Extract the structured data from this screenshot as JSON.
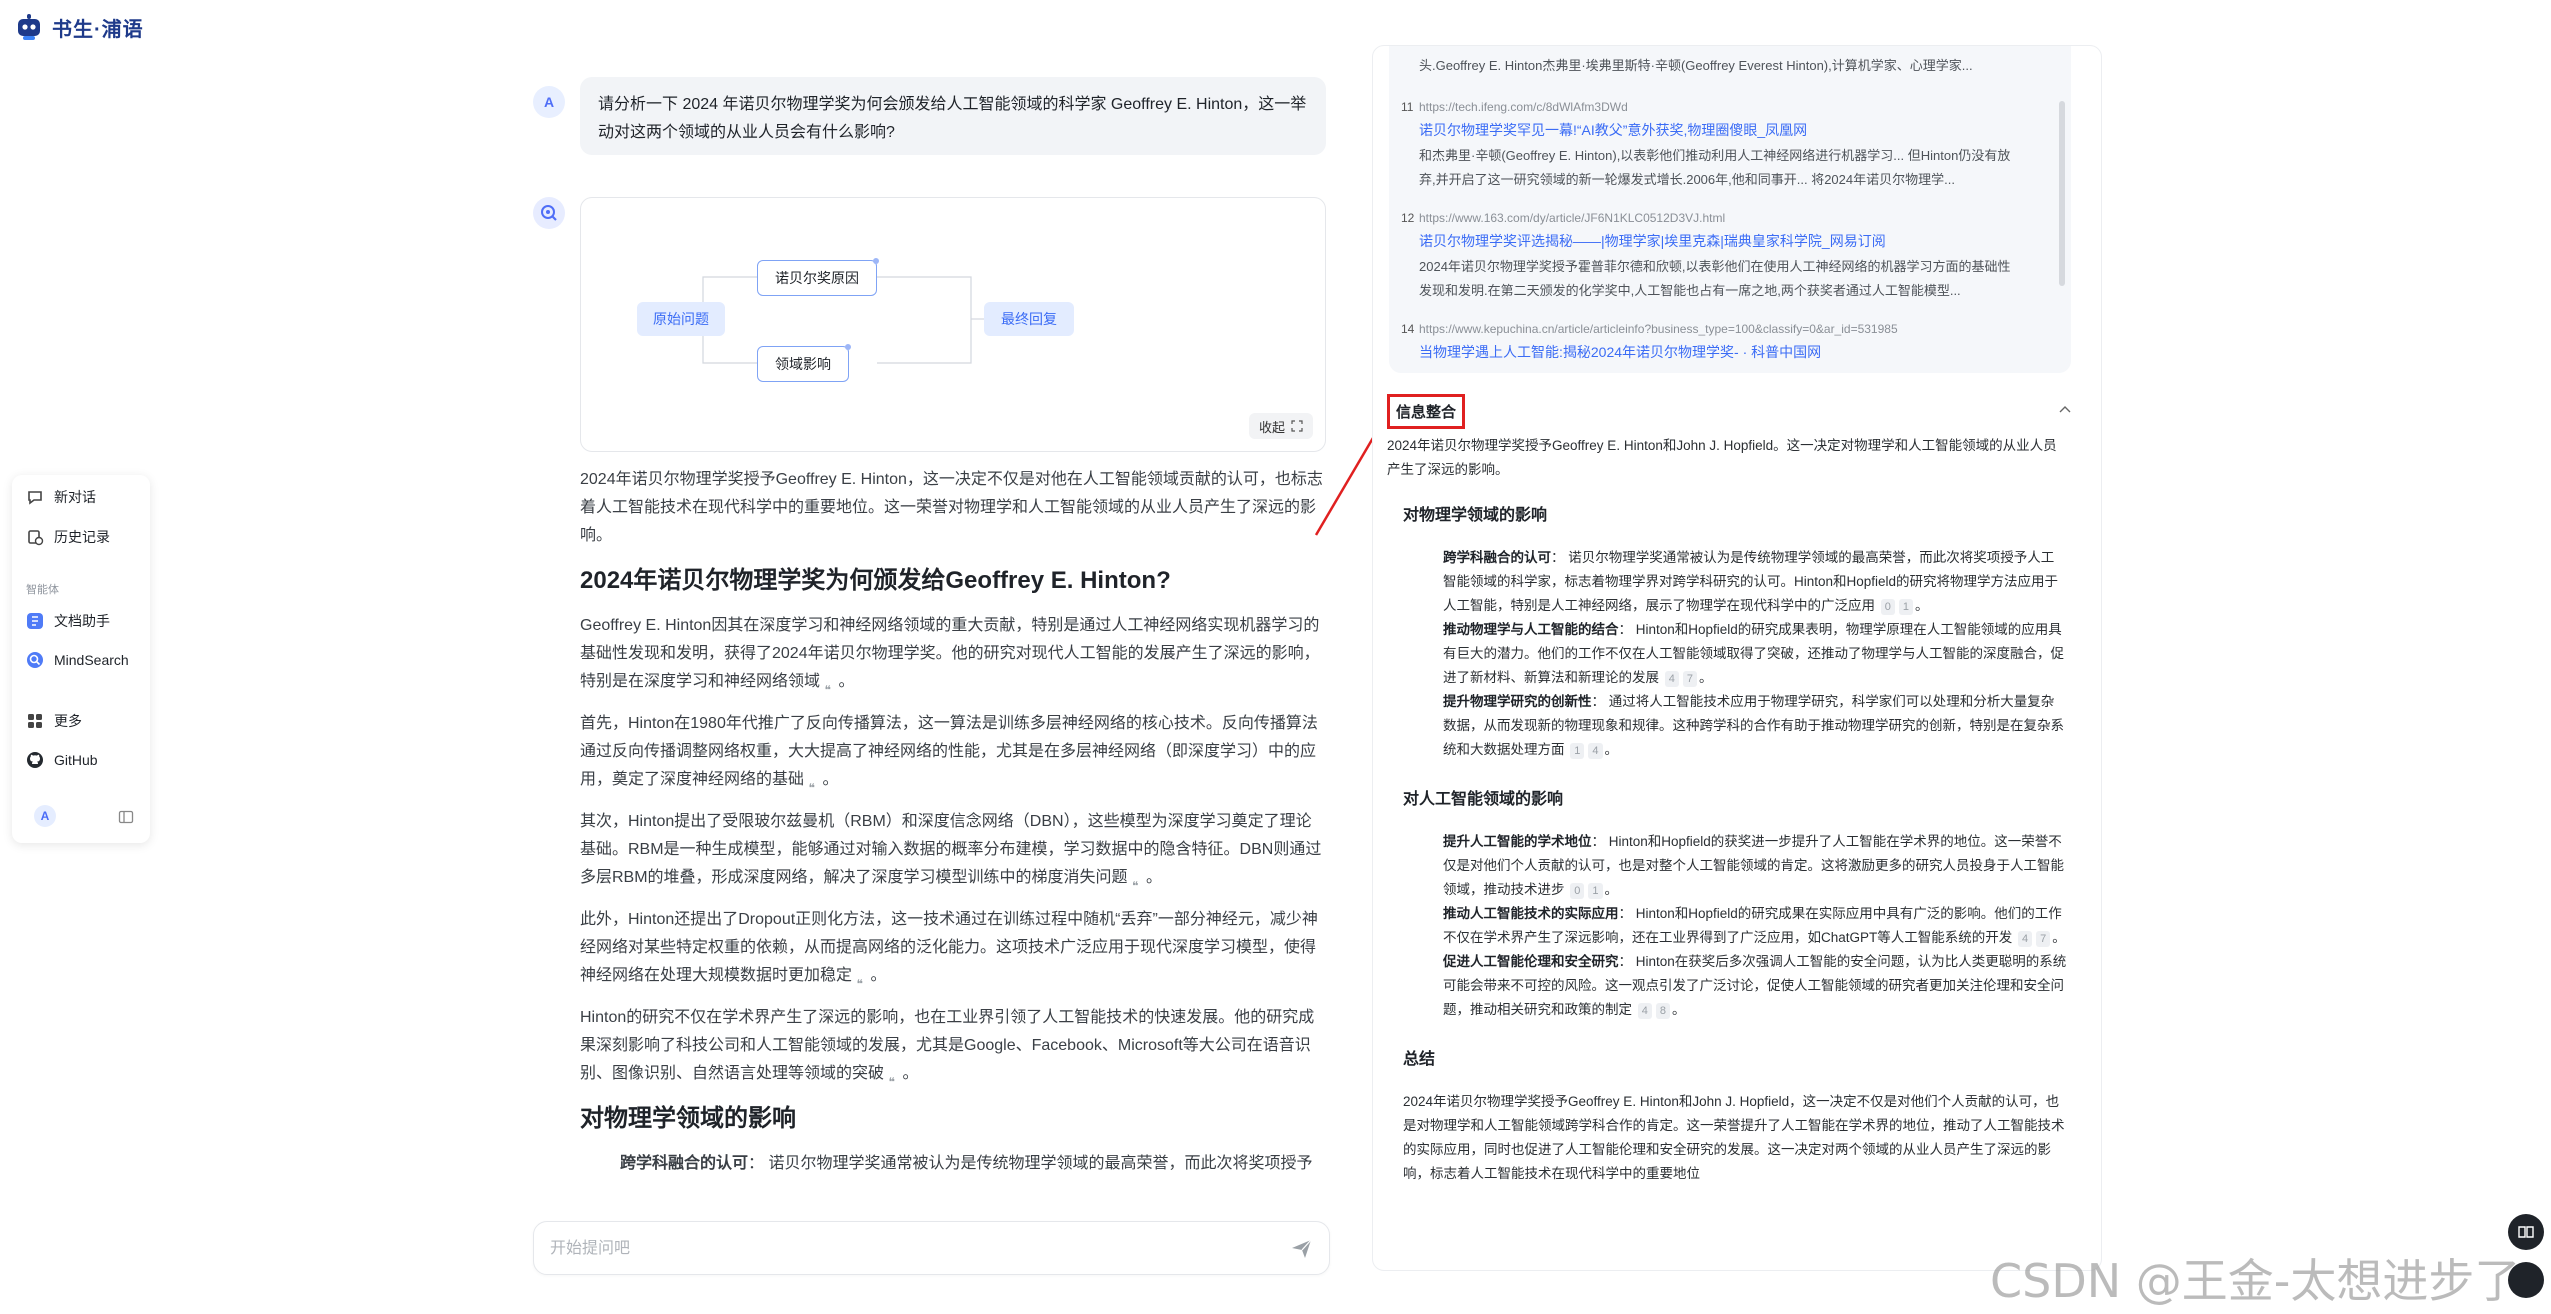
{
  "app": {
    "logo_text": "书生·浦语"
  },
  "sidebar": {
    "new_chat": "新对话",
    "history": "历史记录",
    "section_agents": "智能体",
    "doc_assistant": "文档助手",
    "mindsearch": "MindSearch",
    "more": "更多",
    "github": "GitHub",
    "avatar_letter": "A"
  },
  "chat": {
    "user_avatar_letter": "A",
    "user_question": "请分析一下 2024 年诺贝尔物理学奖为何会颁发给人工智能领域的科学家 Geoffrey E. Hinton，这一举动对这两个领域的从业人员会有什么影响?",
    "graph": {
      "node_origin": "原始问题",
      "node_reason": "诺贝尔奖原因",
      "node_impact": "领域影响",
      "node_final": "最终回复",
      "collapse_label": "收起"
    },
    "answer": {
      "intro": "2024年诺贝尔物理学奖授予Geoffrey E. Hinton，这一决定不仅是对他在人工智能领域贡献的认可，也标志着人工智能技术在现代科学中的重要地位。这一荣誉对物理学和人工智能领域的从业人员产生了深远的影响。",
      "h1": "2024年诺贝尔物理学奖为何颁发给Geoffrey E. Hinton?",
      "p1": "Geoffrey E. Hinton因其在深度学习和神经网络领域的重大贡献，特别是通过人工神经网络实现机器学习的基础性发现和发明，获得了2024年诺贝尔物理学奖。他的研究对现代人工智能的发展产生了深远的影响，特别是在深度学习和神经网络领域",
      "p2": "首先，Hinton在1980年代推广了反向传播算法，这一算法是训练多层神经网络的核心技术。反向传播算法通过反向传播调整网络权重，大大提高了神经网络的性能，尤其是在多层神经网络（即深度学习）中的应用，奠定了深度神经网络的基础",
      "p3": "其次，Hinton提出了受限玻尔兹曼机（RBM）和深度信念网络（DBN），这些模型为深度学习奠定了理论基础。RBM是一种生成模型，能够通过对输入数据的概率分布建模，学习数据中的隐含特征。DBN则通过多层RBM的堆叠，形成深度网络，解决了深度学习模型训练中的梯度消失问题",
      "p4": "此外，Hinton还提出了Dropout正则化方法，这一技术通过在训练过程中随机“丢弃”一部分神经元，减少神经网络对某些特定权重的依赖，从而提高网络的泛化能力。这项技术广泛应用于现代深度学习模型，使得神经网络在处理大规模数据时更加稳定",
      "p5": "Hinton的研究不仅在学术界产生了深远的影响，也在工业界引领了人工智能技术的快速发展。他的研究成果深刻影响了科技公司和人工智能领域的发展，尤其是Google、Facebook、Microsoft等大公司在语音识别、图像识别、自然语言处理等领域的突破",
      "h2": "对物理学领域的影响",
      "b1_label": "跨学科融合的认可",
      "b1_text": "：  诺贝尔物理学奖通常被认为是传统物理学领域的最高荣誉，而此次将奖项授予"
    },
    "input_placeholder": "开始提问吧"
  },
  "sources": [
    {
      "num": "",
      "url": "",
      "title": "",
      "snippet": "头.Geoffrey E. Hinton杰弗里·埃弗里斯特·辛顿(Geoffrey Everest Hinton),计算机学家、心理学家..."
    },
    {
      "num": "11",
      "url": "https://tech.ifeng.com/c/8dWlAfm3DWd",
      "title": "诺贝尔物理学奖罕见一幕!“AI教父”意外获奖,物理圈傻眼_凤凰网",
      "snippet": "和杰弗里·辛顿(Geoffrey E. Hinton),以表彰他们推动利用人工神经网络进行机器学习... 但Hinton仍没有放弃,并开启了这一研究领域的新一轮爆发式增长.2006年,他和同事开... 将2024年诺贝尔物理学..."
    },
    {
      "num": "12",
      "url": "https://www.163.com/dy/article/JF6N1KLC0512D3VJ.html",
      "title": "诺贝尔物理学奖评选揭秘——|物理学家|埃里克森|瑞典皇家科学院_网易订阅",
      "snippet": "2024年诺贝尔物理学奖授予霍普菲尔德和欣顿,以表彰他们在使用人工神经网络的机器学习方面的基础性发现和发明.在第二天颁发的化学奖中,人工智能也占有一席之地,两个获奖者通过人工智能模型..."
    },
    {
      "num": "14",
      "url": "https://www.kepuchina.cn/article/articleinfo?business_type=100&classify=0&ar_id=531985",
      "title": "当物理学遇上人工智能:揭秘2024年诺贝尔物理学奖- · 科普中国网",
      "snippet": ""
    }
  ],
  "integration": {
    "heading": "信息整合",
    "intro": "2024年诺贝尔物理学奖授予Geoffrey E. Hinton和John J. Hopfield。这一决定对物理学和人工智能领域的从业人员产生了深远的影响。",
    "sec1_title": "对物理学领域的影响",
    "sec1_items": [
      {
        "label": "跨学科融合的认可",
        "text": "：  诺贝尔物理学奖通常被认为是传统物理学领域的最高荣誉，而此次将奖项授予人工智能领域的科学家，标志着物理学界对跨学科研究的认可。Hinton和Hopfield的研究将物理学方法应用于人工智能，特别是人工神经网络，展示了物理学在现代科学中的广泛应用",
        "cites": [
          "0",
          "1"
        ]
      },
      {
        "label": "推动物理学与人工智能的结合",
        "text": "：  Hinton和Hopfield的研究成果表明，物理学原理在人工智能领域的应用具有巨大的潜力。他们的工作不仅在人工智能领域取得了突破，还推动了物理学与人工智能的深度融合，促进了新材料、新算法和新理论的发展",
        "cites": [
          "4",
          "7"
        ]
      },
      {
        "label": "提升物理学研究的创新性",
        "text": "：  通过将人工智能技术应用于物理学研究，科学家们可以处理和分析大量复杂数据，从而发现新的物理现象和规律。这种跨学科的合作有助于推动物理学研究的创新，特别是在复杂系统和大数据处理方面",
        "cites": [
          "1",
          "4"
        ]
      }
    ],
    "sec2_title": "对人工智能领域的影响",
    "sec2_items": [
      {
        "label": "提升人工智能的学术地位",
        "text": "：  Hinton和Hopfield的获奖进一步提升了人工智能在学术界的地位。这一荣誉不仅是对他们个人贡献的认可，也是对整个人工智能领域的肯定。这将激励更多的研究人员投身于人工智能领域，推动技术进步",
        "cites": [
          "0",
          "1"
        ]
      },
      {
        "label": "推动人工智能技术的实际应用",
        "text": "：  Hinton和Hopfield的研究成果在实际应用中具有广泛的影响。他们的工作不仅在学术界产生了深远影响，还在工业界得到了广泛应用，如ChatGPT等人工智能系统的开发",
        "cites": [
          "4",
          "7"
        ]
      },
      {
        "label": "促进人工智能伦理和安全研究",
        "text": "：  Hinton在获奖后多次强调人工智能的安全问题，认为比人类更聪明的系统可能会带来不可控的风险。这一观点引发了广泛讨论，促使人工智能领域的研究者更加关注伦理和安全问题，推动相关研究和政策的制定",
        "cites": [
          "4",
          "8"
        ]
      }
    ],
    "sec3_title": "总结",
    "summary": "2024年诺贝尔物理学奖授予Geoffrey E. Hinton和John J. Hopfield，这一决定不仅是对他们个人贡献的认可，也是对物理学和人工智能领域跨学科合作的肯定。这一荣誉提升了人工智能在学术界的地位，推动了人工智能技术的实际应用，同时也促进了人工智能伦理和安全研究的发展。这一决定对两个领域的从业人员产生了深远的影响，标志着人工智能技术在现代科学中的重要地位"
  },
  "watermark": "CSDN @王金-太想进步了",
  "colors": {
    "accent": "#3b6cf5",
    "highlight_border": "#e02020",
    "arrow": "#e02020"
  }
}
